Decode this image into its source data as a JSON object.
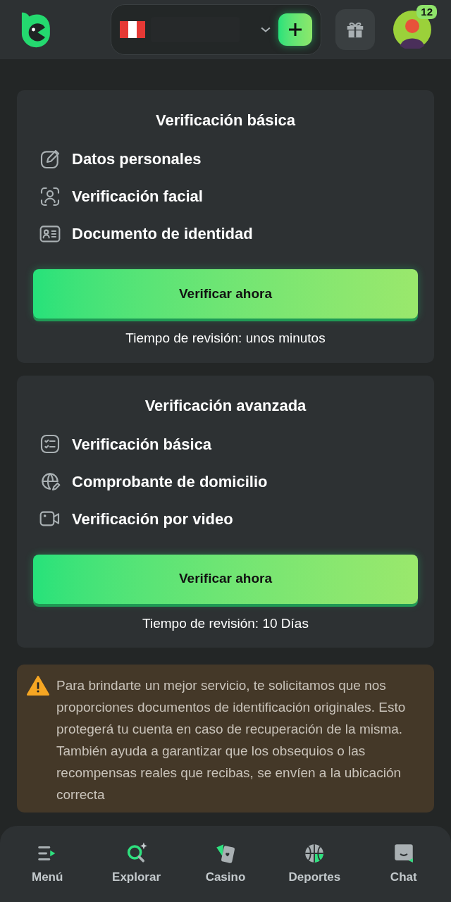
{
  "header": {
    "avatar_badge": "12"
  },
  "cards": [
    {
      "title": "Verificación básica",
      "items": [
        {
          "kind": "edit",
          "label": "Datos personales"
        },
        {
          "kind": "face",
          "label": "Verificación facial"
        },
        {
          "kind": "id",
          "label": "Documento de identidad"
        }
      ],
      "button": "Verificar ahora",
      "note": "Tiempo de revisión: unos minutos"
    },
    {
      "title": "Verificación avanzada",
      "items": [
        {
          "kind": "checklist",
          "label": "Verificación básica"
        },
        {
          "kind": "globe",
          "label": "Comprobante de domicilio"
        },
        {
          "kind": "video",
          "label": "Verificación por video"
        }
      ],
      "button": "Verificar ahora",
      "note": "Tiempo de revisión: 10 Días"
    }
  ],
  "warning": "Para brindarte un mejor servicio, te solicitamos que nos proporciones documentos de identificación originales. Esto protegerá tu cuenta en caso de recuperación de la misma. También ayuda a garantizar que los obsequios o las recompensas reales que recibas, se envíen a la ubicación correcta",
  "nav": [
    {
      "kind": "menu",
      "label": "Menú"
    },
    {
      "kind": "explore",
      "label": "Explorar"
    },
    {
      "kind": "casino",
      "label": "Casino"
    },
    {
      "kind": "sports",
      "label": "Deportes"
    },
    {
      "kind": "chat",
      "label": "Chat"
    }
  ]
}
